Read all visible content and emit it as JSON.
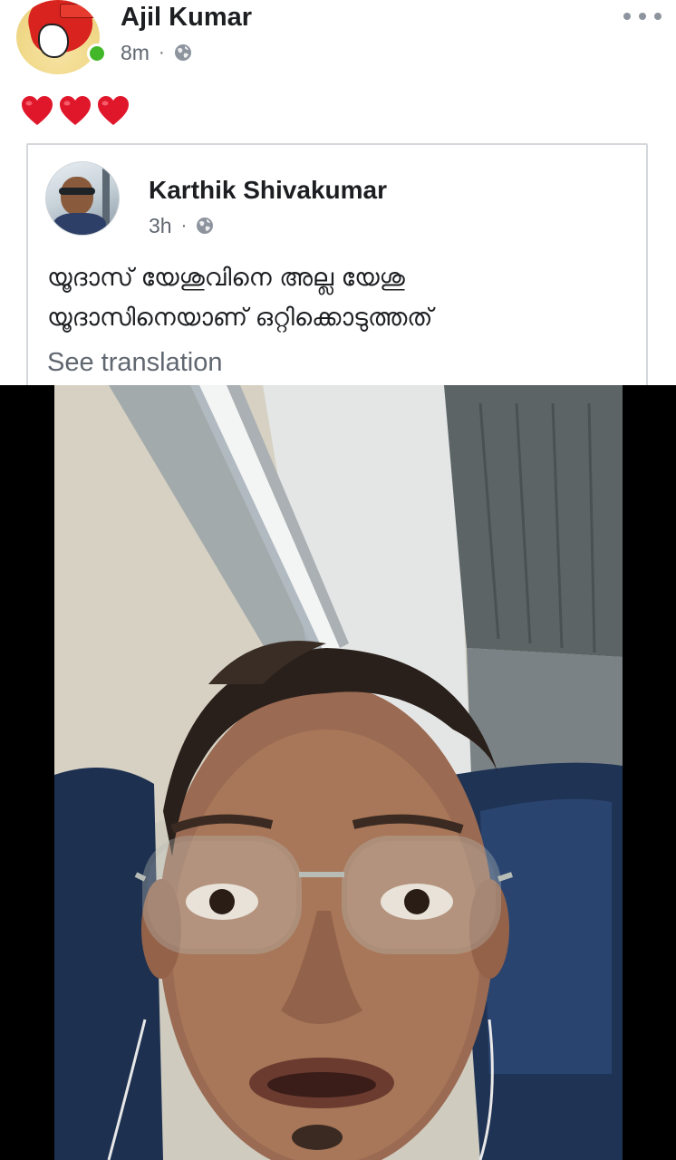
{
  "post": {
    "author": "Ajil Kumar",
    "time": "8m",
    "separator": "·",
    "text_icons": [
      "heart-icon",
      "heart-icon",
      "heart-icon"
    ],
    "privacy_icon": "globe-icon",
    "more_icon": "more-icon"
  },
  "shared_post": {
    "author": "Karthik Shivakumar",
    "time": "3h",
    "separator": "·",
    "text_lines": [
      "യൂദാസ് യേശുവിനെ അല്ല യേശു",
      "യൂദാസിനെയാണ് ഒറ്റിക്കൊടുത്തത്"
    ],
    "see_translation": "See translation",
    "privacy_icon": "globe-icon"
  },
  "video": {
    "description_icon": "video-frame"
  },
  "colors": {
    "name": "#1c1e21",
    "meta": "#606770",
    "online": "#42b72a",
    "heart": "#e0162b",
    "card_border": "#d4d7dc",
    "letterbox": "#000000"
  }
}
